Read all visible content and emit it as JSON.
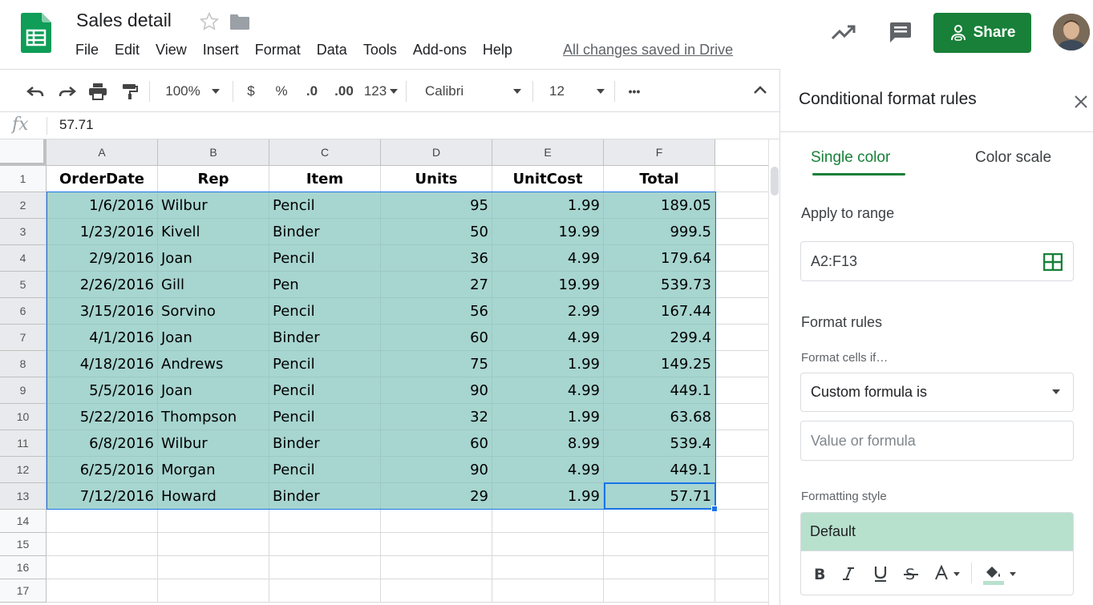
{
  "header": {
    "title": "Sales detail",
    "menu": [
      "File",
      "Edit",
      "View",
      "Insert",
      "Format",
      "Data",
      "Tools",
      "Add-ons",
      "Help"
    ],
    "save_status": "All changes saved in Drive",
    "share_label": "Share",
    "icons": {
      "logo": "sheets-logo-icon",
      "star": "star-icon",
      "folder": "folder-icon",
      "trend": "trending-up-icon",
      "comment": "comment-icon",
      "share": "person-link-icon"
    }
  },
  "toolbar": {
    "zoom": "100%",
    "currency": "$",
    "percent": "%",
    "decrease_decimal": ".0",
    "increase_decimal": ".00",
    "number_format": "123",
    "font": "Calibri",
    "font_size": "12",
    "more": "•••"
  },
  "formula_bar": {
    "fx": "fx",
    "value": "57.71"
  },
  "grid": {
    "columns": [
      "A",
      "B",
      "C",
      "D",
      "E",
      "F"
    ],
    "rows": [
      "1",
      "2",
      "3",
      "4",
      "5",
      "6",
      "7",
      "8",
      "9",
      "10",
      "11",
      "12",
      "13",
      "14",
      "15",
      "16",
      "17"
    ],
    "header": [
      "OrderDate",
      "Rep",
      "Item",
      "Units",
      "UnitCost",
      "Total"
    ],
    "data": [
      [
        "1/6/2016",
        "Wilbur",
        "Pencil",
        "95",
        "1.99",
        "189.05"
      ],
      [
        "1/23/2016",
        "Kivell",
        "Binder",
        "50",
        "19.99",
        "999.5"
      ],
      [
        "2/9/2016",
        "Joan",
        "Pencil",
        "36",
        "4.99",
        "179.64"
      ],
      [
        "2/26/2016",
        "Gill",
        "Pen",
        "27",
        "19.99",
        "539.73"
      ],
      [
        "3/15/2016",
        "Sorvino",
        "Pencil",
        "56",
        "2.99",
        "167.44"
      ],
      [
        "4/1/2016",
        "Joan",
        "Binder",
        "60",
        "4.99",
        "299.4"
      ],
      [
        "4/18/2016",
        "Andrews",
        "Pencil",
        "75",
        "1.99",
        "149.25"
      ],
      [
        "5/5/2016",
        "Joan",
        "Pencil",
        "90",
        "4.99",
        "449.1"
      ],
      [
        "5/22/2016",
        "Thompson",
        "Pencil",
        "32",
        "1.99",
        "63.68"
      ],
      [
        "6/8/2016",
        "Wilbur",
        "Binder",
        "60",
        "8.99",
        "539.4"
      ],
      [
        "6/25/2016",
        "Morgan",
        "Pencil",
        "90",
        "4.99",
        "449.1"
      ],
      [
        "7/12/2016",
        "Howard",
        "Binder",
        "29",
        "1.99",
        "57.71"
      ]
    ],
    "fill_color": "#a7d5d0",
    "selection_color": "#1a73e8"
  },
  "panel": {
    "title": "Conditional format rules",
    "tab_single": "Single color",
    "tab_scale": "Color scale",
    "apply_label": "Apply to range",
    "range_value": "A2:F13",
    "rules_label": "Format rules",
    "format_if_label": "Format cells if…",
    "condition": "Custom formula is",
    "value_placeholder": "Value or formula",
    "style_label": "Formatting style",
    "style_preview": "Default",
    "style_preview_color": "#b7e1cd",
    "accent_color": "#188038"
  }
}
